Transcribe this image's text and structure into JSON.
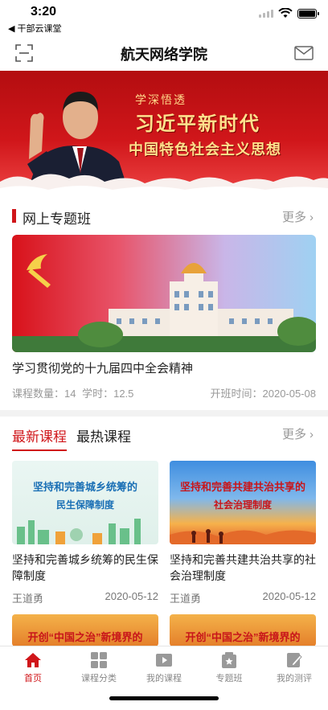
{
  "status": {
    "time": "3:20",
    "back_app": "◀ 干部云课堂"
  },
  "header": {
    "title": "航天网络学院"
  },
  "banner": {
    "line1": "学深悟透",
    "line2": "习近平新时代",
    "line3": "中国特色社会主义思想"
  },
  "special_class": {
    "title": "网上专题班",
    "more": "更多",
    "item": {
      "name": "学习贯彻党的十九届四中全会精神",
      "course_count_label": "课程数量：14",
      "hours_label": "学时：12.5",
      "open_label": "开班时间：2020-05-08"
    }
  },
  "courses": {
    "tabs": [
      "最新课程",
      "最热课程"
    ],
    "more": "更多",
    "items": [
      {
        "img_line1": "坚持和完善城乡统筹的",
        "img_line2": "民生保障制度",
        "title": "坚持和完善城乡统筹的民生保障制度",
        "teacher": "王道勇",
        "date": "2020-05-12"
      },
      {
        "img_line1": "坚持和完善共建共治共享的",
        "img_line2": "社会治理制度",
        "title": "坚持和完善共建共治共享的社会治理制度",
        "teacher": "王道勇",
        "date": "2020-05-12"
      }
    ],
    "peek": [
      "开创“中国之治”新境界的",
      "开创“中国之治”新境界的"
    ]
  },
  "tabbar": {
    "items": [
      {
        "label": "首页",
        "icon": "home-icon",
        "active": true
      },
      {
        "label": "课程分类",
        "icon": "grid-icon"
      },
      {
        "label": "我的课程",
        "icon": "play-icon"
      },
      {
        "label": "专题班",
        "icon": "star-board-icon"
      },
      {
        "label": "我的测评",
        "icon": "edit-icon"
      }
    ]
  },
  "colors": {
    "brand_red": "#d0161a",
    "muted": "#999999"
  }
}
